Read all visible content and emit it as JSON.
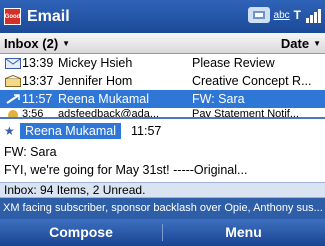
{
  "app": {
    "title": "Email",
    "icon_label": "Good",
    "status": {
      "input_mode": "abc",
      "signal_label": "T"
    }
  },
  "header": {
    "folder": "Inbox (2)",
    "sort": "Date"
  },
  "messages": [
    {
      "time": "13:39",
      "sender": "Mickey Hsieh",
      "subject": "Please Review",
      "icon": "envelope-attachment-icon",
      "selected": false
    },
    {
      "time": "13:37",
      "sender": "Jennifer Hom",
      "subject": "Creative Concept R...",
      "icon": "envelope-read-icon",
      "selected": false
    },
    {
      "time": "11:57",
      "sender": "Reena Mukamal",
      "subject": "FW: Sara",
      "icon": "forward-icon",
      "selected": true
    },
    {
      "time": "3:56",
      "sender": "adsfeedback@ada...",
      "subject": "Pay Statement Notif...",
      "icon": "envelope-icon",
      "selected": false
    }
  ],
  "preview": {
    "from": "Reena Mukamal",
    "time": "11:57",
    "subject": "FW: Sara",
    "body": "FYI, we're going for May 31st! -----Original..."
  },
  "status_line": "Inbox: 94 Items, 2 Unread.",
  "ticker": "XM facing subscriber, sponsor backlash over Opie, Anthony sus...",
  "softkeys": {
    "left": "Compose",
    "right": "Menu"
  },
  "colors": {
    "titlebar": "#2f63b8",
    "selection": "#2f77d6",
    "ticker": "#2e5ea8",
    "softbar": "#1a4592"
  }
}
